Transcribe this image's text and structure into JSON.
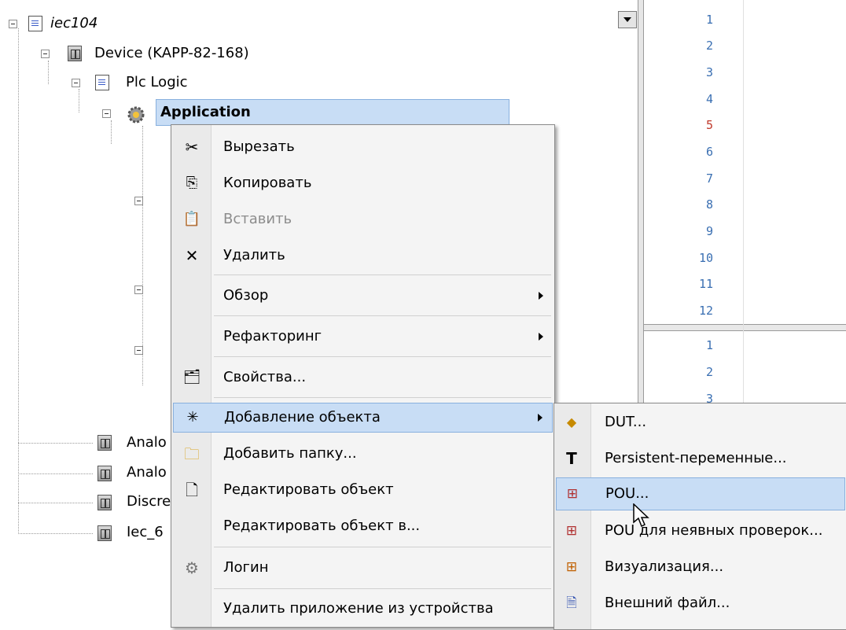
{
  "tree": {
    "root": "iec104",
    "device": "Device (KAPP-82-168)",
    "plc_logic": "Plc Logic",
    "application": "Application",
    "items_bottom": [
      "Analo",
      "Analo",
      "Discre",
      "Iec_6"
    ]
  },
  "code_panel": {
    "lines_top": [
      "1",
      "2",
      "3",
      "4",
      "5",
      "6",
      "7",
      "8",
      "9",
      "10",
      "11",
      "12"
    ],
    "lines_bottom": [
      "1",
      "2",
      "3"
    ],
    "current_line_color": "#c0392b",
    "line_number_color": "#3a6fb2"
  },
  "context_menu": {
    "items": [
      {
        "label": "Вырезать",
        "icon": "cut-icon"
      },
      {
        "label": "Копировать",
        "icon": "copy-icon"
      },
      {
        "label": "Вставить",
        "icon": "paste-icon",
        "disabled": true
      },
      {
        "label": "Удалить",
        "icon": "delete-icon"
      },
      {
        "label": "Обзор",
        "submenu": true
      },
      {
        "label": "Рефакторинг",
        "submenu": true
      },
      {
        "label": "Свойства...",
        "icon": "properties-icon"
      },
      {
        "label": "Добавление объекта",
        "icon": "add-object-icon",
        "submenu": true,
        "highlighted": true
      },
      {
        "label": "Добавить папку...",
        "icon": "folder-icon"
      },
      {
        "label": "Редактировать объект",
        "icon": "edit-object-icon"
      },
      {
        "label": "Редактировать объект в..."
      },
      {
        "label": "Логин",
        "icon": "login-icon"
      },
      {
        "label": "Удалить приложение из устройства"
      }
    ]
  },
  "submenu": {
    "items": [
      {
        "label": "DUT...",
        "icon": "dut-icon"
      },
      {
        "label": "Persistent-переменные...",
        "icon": "persistent-icon"
      },
      {
        "label": "POU...",
        "icon": "pou-icon",
        "highlighted": true
      },
      {
        "label": "POU для неявных проверок...",
        "icon": "pou-checks-icon"
      },
      {
        "label": "Визуализация...",
        "icon": "visualization-icon"
      },
      {
        "label": "Внешний файл...",
        "icon": "external-file-icon"
      }
    ]
  },
  "colors": {
    "highlight_bg": "#c8ddf5",
    "highlight_border": "#88b0de",
    "menu_bg": "#f4f4f4"
  }
}
